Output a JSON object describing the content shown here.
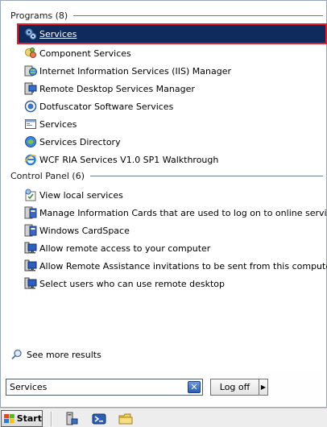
{
  "programs": {
    "header": "Programs (8)",
    "items": [
      {
        "label": "Services",
        "icon": "gear-icon",
        "selected": true
      },
      {
        "label": "Component Services",
        "icon": "component-services-icon"
      },
      {
        "label": "Internet Information Services (IIS) Manager",
        "icon": "iis-manager-icon"
      },
      {
        "label": "Remote Desktop Services Manager",
        "icon": "remote-desktop-manager-icon"
      },
      {
        "label": "Dotfuscator Software Services",
        "icon": "dotfuscator-icon"
      },
      {
        "label": "Services",
        "icon": "services-window-icon"
      },
      {
        "label": "Services Directory",
        "icon": "services-directory-icon"
      },
      {
        "label": "WCF RIA Services V1.0 SP1 Walkthrough",
        "icon": "ie-document-icon"
      }
    ]
  },
  "control_panel": {
    "header": "Control Panel (6)",
    "items": [
      {
        "label": "View local services",
        "icon": "view-services-icon"
      },
      {
        "label": "Manage Information Cards that are used to log on to online services",
        "icon": "cardspace-icon"
      },
      {
        "label": "Windows CardSpace",
        "icon": "cardspace-icon"
      },
      {
        "label": "Allow remote access to your computer",
        "icon": "system-icon"
      },
      {
        "label": "Allow Remote Assistance invitations to be sent from this computer",
        "icon": "system-icon"
      },
      {
        "label": "Select users who can use remote desktop",
        "icon": "system-icon"
      }
    ]
  },
  "see_more": "See more results",
  "search": {
    "value": "Services"
  },
  "logoff_label": "Log off",
  "start_label": "Start",
  "colors": {
    "selection_bg": "#0f2a5c",
    "selection_border": "#e0202a",
    "divider": "#6f7d91"
  }
}
